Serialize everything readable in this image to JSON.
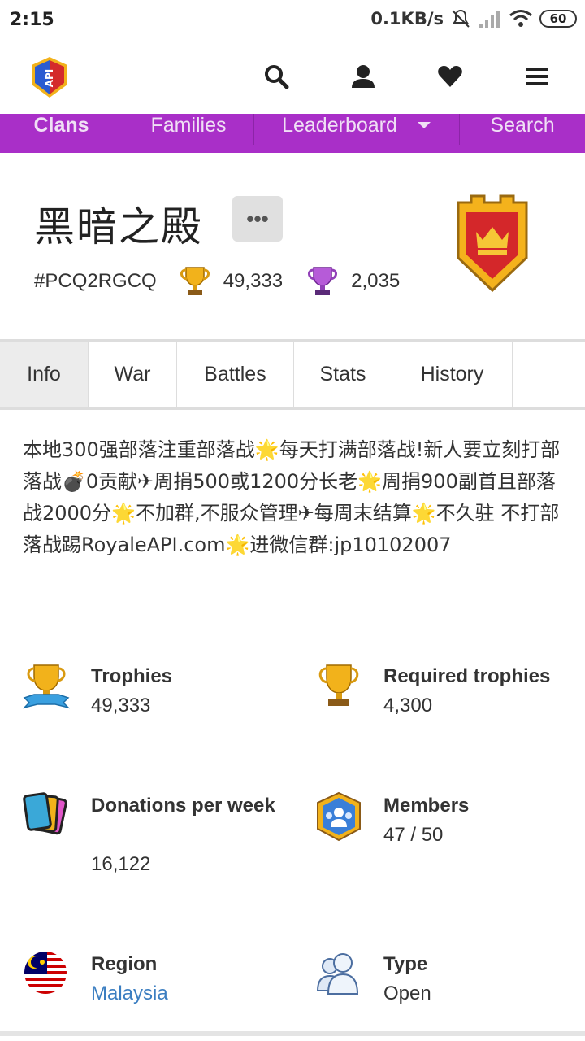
{
  "status": {
    "time": "2:15",
    "speed": "0.1KB/s",
    "battery": "60"
  },
  "appbar": {
    "logo_text": "API"
  },
  "nav": [
    {
      "label": "Clans"
    },
    {
      "label": "Families"
    },
    {
      "label": "Leaderboard"
    },
    {
      "label": "Search"
    }
  ],
  "clan": {
    "name": "黑暗之殿",
    "more": "•••",
    "tag": "#PCQ2RGCQ",
    "trophies": "49,333",
    "war_trophies": "2,035"
  },
  "tabs": [
    {
      "label": "Info"
    },
    {
      "label": "War"
    },
    {
      "label": "Battles"
    },
    {
      "label": "Stats"
    },
    {
      "label": "History"
    }
  ],
  "description": "本地300强部落注重部落战🌟每天打满部落战!新人要立刻打部落战💣0贡献✈周捐500或1200分长老🌟周捐900副首且部落战2000分🌟不加群,不服众管理✈每周末结算🌟不久驻 不打部落战踢RoyaleAPI.com🌟进微信群:jp10102007",
  "stats": {
    "trophies": {
      "label": "Trophies",
      "value": "49,333",
      "icon": "trophy-ribbon-icon"
    },
    "required": {
      "label": "Required trophies",
      "value": "4,300",
      "icon": "trophy-icon"
    },
    "donations": {
      "label": "Donations per week",
      "value": "16,122",
      "icon": "cards-icon"
    },
    "members": {
      "label": "Members",
      "value": "47 / 50",
      "icon": "members-icon"
    },
    "region": {
      "label": "Region",
      "value": "Malaysia",
      "icon": "malaysia-flag-icon"
    },
    "type": {
      "label": "Type",
      "value": "Open",
      "icon": "people-icon"
    }
  },
  "colors": {
    "nav_purple": "#a92fc8",
    "link": "#3b7ec1"
  }
}
